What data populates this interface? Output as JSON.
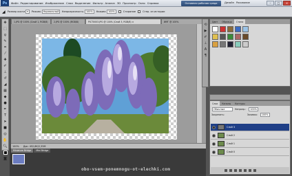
{
  "menubar": {
    "app_logo": "Ps",
    "items": [
      "Файл",
      "Редактирование",
      "Изображение",
      "Слои",
      "Выделение",
      "Фильтр",
      "Анализ",
      "3D",
      "Просмотр",
      "Окно",
      "Справка"
    ],
    "workspace_label": "Основная рабочая среда",
    "right_items": [
      "Дизайн",
      "Рисование"
    ]
  },
  "options": {
    "brush_label": "Размер кисти",
    "mode_label": "Режим:",
    "mode_value": "Нормальный",
    "opacity_label": "Непрозрачность:",
    "opacity_value": "100%",
    "flow_label": "Нажим:",
    "flow_value": "100%",
    "cb1_label": "Стирание",
    "cb2_label": "Стер. из истории"
  },
  "tabs": [
    "1.JPG @ 100% (Слой 1, RGB/8)",
    "2.JPG @ 100% (RGB/8)",
    "PICT0003.JPG @ 100% (Слой 3, RGB/8) ×",
    "ИМГ @ 100%"
  ],
  "status": {
    "zoom": "100%",
    "doc": "Док: 452,8К/2,35М"
  },
  "filmstrip": {
    "tabs": [
      "Miniature Bridge",
      "Mini Bridge"
    ]
  },
  "watermark": "obo-vsem-ponemnogu-ot-elechki.com",
  "panels": {
    "swatch_tabs": [
      "Цвет",
      "Образцы",
      "Стили"
    ],
    "layers_tabs": [
      "Слои",
      "Каналы",
      "Контуры"
    ],
    "blend_mode": "Обычные",
    "opacity_label": "Непрозр.:",
    "opacity_value": "100%",
    "lock_label": "Закрепить:",
    "fill_label": "Заливка:",
    "fill_value": "100%",
    "layers": [
      "Слой 3",
      "Слой 2",
      "Слой 1",
      "Слой 0"
    ]
  },
  "colors": {
    "selected_layer": "#1f3f87"
  }
}
